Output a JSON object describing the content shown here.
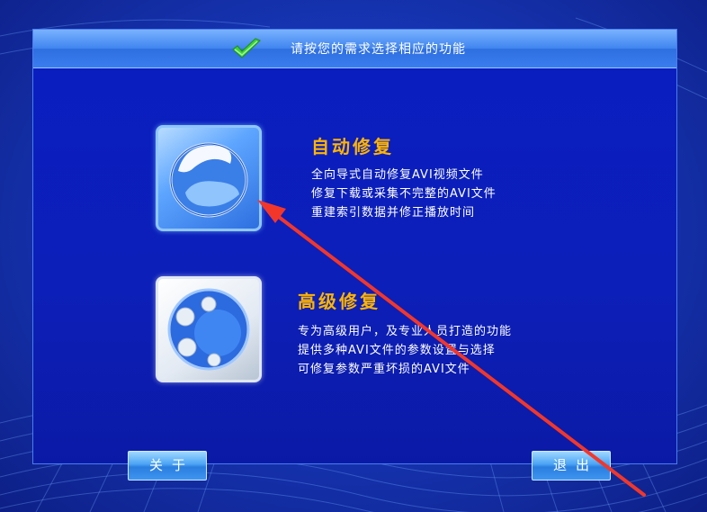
{
  "header": {
    "title": "请按您的需求选择相应的功能",
    "icon": "checkmark-icon"
  },
  "options": [
    {
      "id": "auto",
      "icon": "auto-repair-icon",
      "title": "自动修复",
      "lines": [
        "全向导式自动修复AVI视频文件",
        "修复下载或采集不完整的AVI文件",
        "重建索引数据并修正播放时间"
      ]
    },
    {
      "id": "advanced",
      "icon": "advanced-repair-icon",
      "title": "高级修复",
      "lines": [
        "专为高级用户，及专业人员打造的功能",
        "提供多种AVI文件的参数设置与选择",
        "可修复参数严重坏损的AVI文件"
      ]
    }
  ],
  "buttons": {
    "about": "关于",
    "exit": "退出"
  },
  "colors": {
    "accent_title": "#ffb400",
    "annotation_arrow": "#f2372a",
    "panel": "#0c1fb8"
  }
}
